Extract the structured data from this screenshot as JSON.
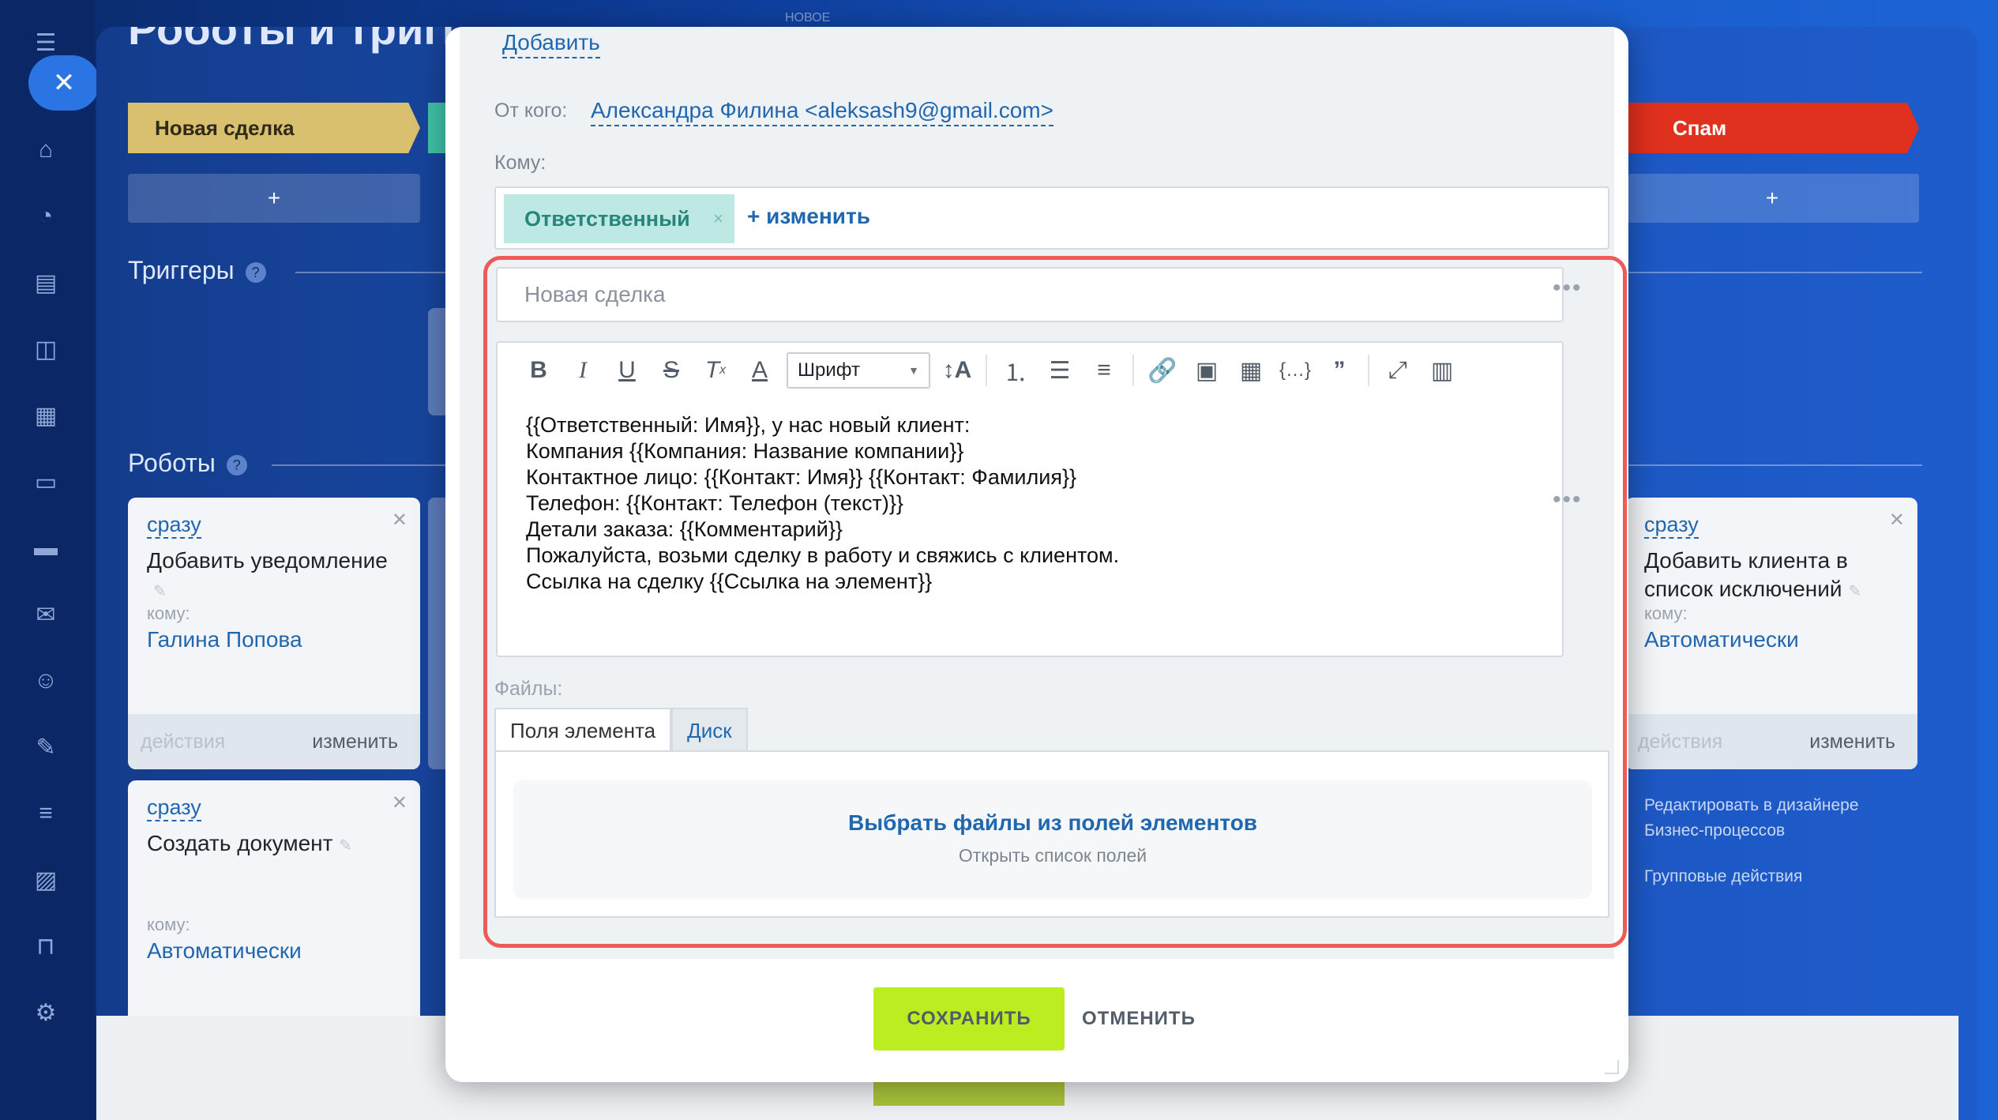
{
  "background": {
    "page_title": "Роботы и триггеры",
    "top_tag": "НОВОЕ",
    "stages": [
      {
        "label": "Новая сделка",
        "color": "#d9c06e"
      },
      {
        "label": "Спам",
        "color": "#e0301e"
      }
    ],
    "add_plus": "+",
    "triggers_title": "Триггеры",
    "robots_title": "Роботы",
    "help_mark": "?",
    "robots": [
      {
        "when": "сразу",
        "name": "Добавить уведомление",
        "to_label": "кому:",
        "to_value": "Галина Попова",
        "action_label": "действия",
        "edit_label": "изменить"
      },
      {
        "when": "сразу",
        "name": "Создать документ",
        "to_label": "кому:",
        "to_value": "Автоматически"
      },
      {
        "when": "сразу",
        "name": "Добавить клиента в список исключений",
        "to_label": "кому:",
        "to_value": "Автоматически",
        "action_label": "действия",
        "edit_label": "изменить"
      }
    ],
    "side_links": [
      "Редактировать в дизайнере",
      "Бизнес-процессов",
      "Групповые действия"
    ],
    "close_symbol": "✕"
  },
  "modal": {
    "add_link": "Добавить",
    "from_label": "От кого:",
    "from_value": "Александра Филина <aleksash9@gmail.com>",
    "to_label": "Кому:",
    "recipient_chip": "Ответственный",
    "chip_remove": "×",
    "change_link": "+ изменить",
    "subject": "Новая сделка",
    "more_dots": "•••",
    "font_select": "Шрифт",
    "body_lines": [
      "{{Ответственный: Имя}}, у нас новый клиент:",
      "Компания {{Компания: Название компании}}",
      "Контактное лицо: {{Контакт: Имя}} {{Контакт: Фамилия}}",
      "Телефон: {{Контакт: Телефон (текст)}}",
      "Детали заказа: {{Комментарий}}",
      "Пожалуйста, возьми сделку в работу и свяжись с клиентом.",
      "Ссылка на сделку {{Ссылка на элемент}}"
    ],
    "files_label": "Файлы:",
    "tabs": [
      "Поля элемента",
      "Диск"
    ],
    "pick_files": "Выбрать файлы из полей элементов",
    "open_list": "Открыть список полей",
    "save": "СОХРАНИТЬ",
    "cancel": "ОТМЕНИТЬ",
    "highlight_color": "#ec5b55",
    "accent_color": "#bbed21"
  }
}
